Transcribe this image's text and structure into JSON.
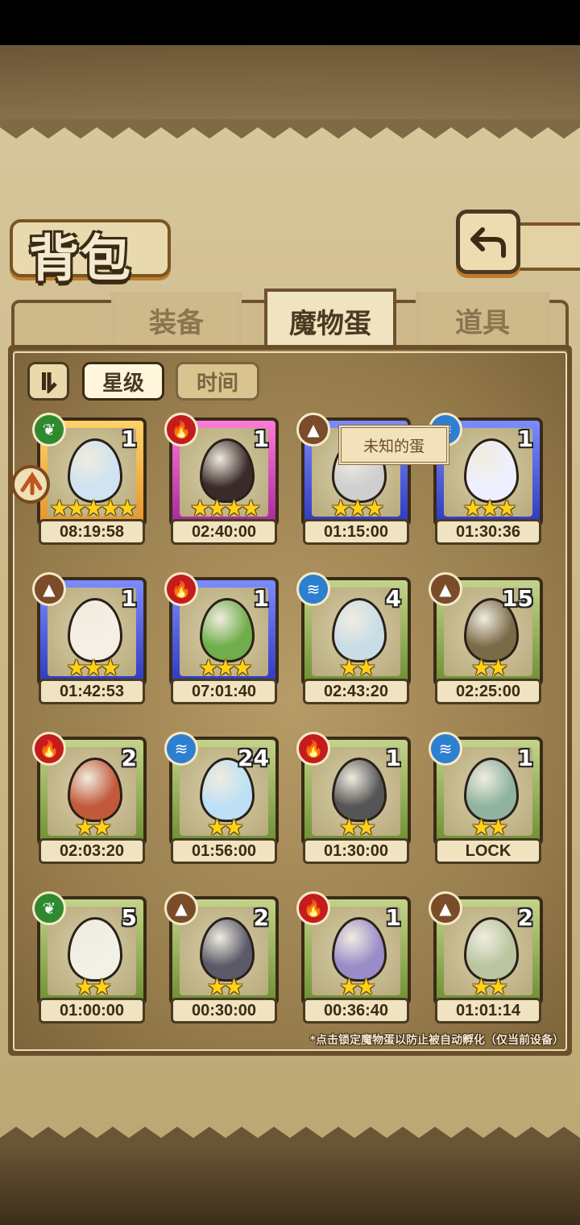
{
  "header": {
    "title": "背包",
    "back_icon": "back-arrow-icon"
  },
  "tabs": [
    {
      "label": "装备",
      "active": false
    },
    {
      "label": "魔物蛋",
      "active": true
    },
    {
      "label": "道具",
      "active": false
    }
  ],
  "sort": {
    "order_icon": "pause-sort-icon",
    "star_label": "星级",
    "time_label": "时间",
    "active": "星级"
  },
  "tooltip": {
    "text": "未知的蛋"
  },
  "eggs": [
    {
      "element": "grass",
      "count": "1",
      "stars": "★★★★★",
      "timer": "08:19:58",
      "frame": "gold",
      "art": "pocket-watch"
    },
    {
      "element": "fire",
      "count": "1",
      "stars": "★★★★",
      "timer": "02:40:00",
      "frame": "pink",
      "art": "dark-crystal-egg"
    },
    {
      "element": "earth",
      "count": "",
      "stars": "★★★",
      "timer": "01:15:00",
      "frame": "blue",
      "art": "chained-cleaver-egg"
    },
    {
      "element": "water",
      "count": "1",
      "stars": "★★★",
      "timer": "01:30:36",
      "frame": "blue",
      "art": "ribbon-egg"
    },
    {
      "element": "earth",
      "count": "1",
      "stars": "★★★",
      "timer": "01:42:53",
      "frame": "blue",
      "art": "fluffy-egg"
    },
    {
      "element": "fire",
      "count": "1",
      "stars": "★★★",
      "timer": "07:01:40",
      "frame": "blue",
      "art": "cabbage-egg"
    },
    {
      "element": "water",
      "count": "4",
      "stars": "★★",
      "timer": "02:43:20",
      "frame": "green",
      "art": "ice-rock-egg"
    },
    {
      "element": "earth",
      "count": "15",
      "stars": "★★",
      "timer": "02:25:00",
      "frame": "green",
      "art": "vine-egg"
    },
    {
      "element": "fire",
      "count": "2",
      "stars": "★★",
      "timer": "02:03:20",
      "frame": "green",
      "art": "lava-egg"
    },
    {
      "element": "water",
      "count": "24",
      "stars": "★★",
      "timer": "01:56:00",
      "frame": "green",
      "art": "water-drop-egg"
    },
    {
      "element": "fire",
      "count": "1",
      "stars": "★★",
      "timer": "01:30:00",
      "frame": "green",
      "art": "stone-egg"
    },
    {
      "element": "water",
      "count": "1",
      "stars": "★★",
      "timer": "LOCK",
      "frame": "green",
      "art": "shell-egg"
    },
    {
      "element": "grass",
      "count": "5",
      "stars": "★★",
      "timer": "01:00:00",
      "frame": "green",
      "art": "radish-egg"
    },
    {
      "element": "earth",
      "count": "2",
      "stars": "★★",
      "timer": "00:30:00",
      "frame": "green",
      "art": "hat-egg"
    },
    {
      "element": "fire",
      "count": "1",
      "stars": "★★",
      "timer": "00:36:40",
      "frame": "green",
      "art": "bud-egg"
    },
    {
      "element": "earth",
      "count": "2",
      "stars": "★★",
      "timer": "01:01:14",
      "frame": "green",
      "art": "leaf-egg"
    }
  ],
  "footer_note": "*点击锁定魔物蛋以防止被自动孵化（仅当前设备）",
  "colors": {
    "paper": "#c9b585",
    "panel_border": "#6a4f2a",
    "star": "#ffd21a"
  }
}
